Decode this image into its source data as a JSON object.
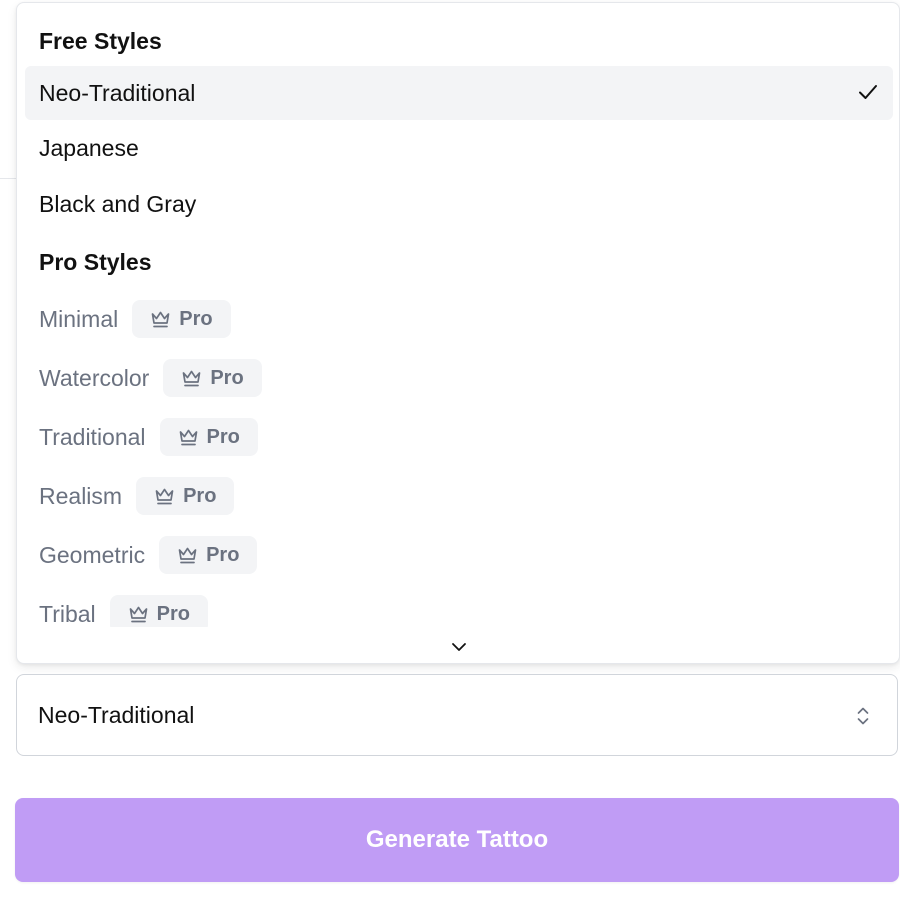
{
  "dropdown": {
    "free_group_label": "Free Styles",
    "free_options": [
      {
        "label": "Neo-Traditional",
        "selected": true
      },
      {
        "label": "Japanese",
        "selected": false
      },
      {
        "label": "Black and Gray",
        "selected": false
      }
    ],
    "pro_group_label": "Pro Styles",
    "pro_badge_label": "Pro",
    "pro_options": [
      {
        "label": "Minimal"
      },
      {
        "label": "Watercolor"
      },
      {
        "label": "Traditional"
      },
      {
        "label": "Realism"
      },
      {
        "label": "Geometric"
      },
      {
        "label": "Tribal"
      }
    ],
    "icons": {
      "selected": "check-icon",
      "pro": "crown-icon",
      "scroll": "chevron-down-icon"
    }
  },
  "style_select": {
    "value": "Neo-Traditional",
    "icon": "chevron-up-down-icon"
  },
  "generate_button": {
    "label": "Generate Tattoo"
  },
  "colors": {
    "accent": "#c09cf5",
    "selected_bg": "#f3f4f6",
    "muted_text": "#6b7280"
  }
}
